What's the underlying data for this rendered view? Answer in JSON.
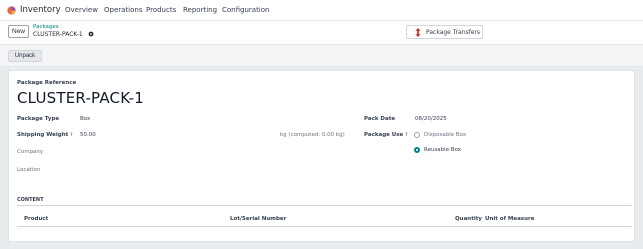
{
  "nav": {
    "app_name": "Inventory",
    "menu": [
      "Overview",
      "Operations",
      "Products",
      "Reporting",
      "Configuration"
    ]
  },
  "control": {
    "new_label": "New",
    "breadcrumb_parent": "Packages",
    "breadcrumb_current": "CLUSTER-PACK-1",
    "smart_button_label": "Package Transfers"
  },
  "status": {
    "unpack_label": "Unpack"
  },
  "form": {
    "reference_label": "Package Reference",
    "reference_value": "CLUSTER-PACK-1",
    "package_type_label": "Package Type",
    "package_type_value": "Box",
    "shipping_weight_label": "Shipping Weight",
    "help_mark": "?",
    "shipping_weight_value": "50.00",
    "weight_unit": "kg (computed: 0.00 kg)",
    "company_label": "Company",
    "location_label": "Location",
    "pack_date_label": "Pack Date",
    "pack_date_value": "08/20/2025",
    "package_use_label": "Package Use",
    "package_use_options": [
      "Disposable Box",
      "Reusable Box"
    ],
    "package_use_selected": "Reusable Box"
  },
  "content": {
    "title": "CONTENT",
    "columns": [
      "Product",
      "Lot/Serial Number",
      "Quantity",
      "Unit of Measure"
    ]
  },
  "colors": {
    "accent": "#017e84",
    "logo": "#e8643c"
  }
}
